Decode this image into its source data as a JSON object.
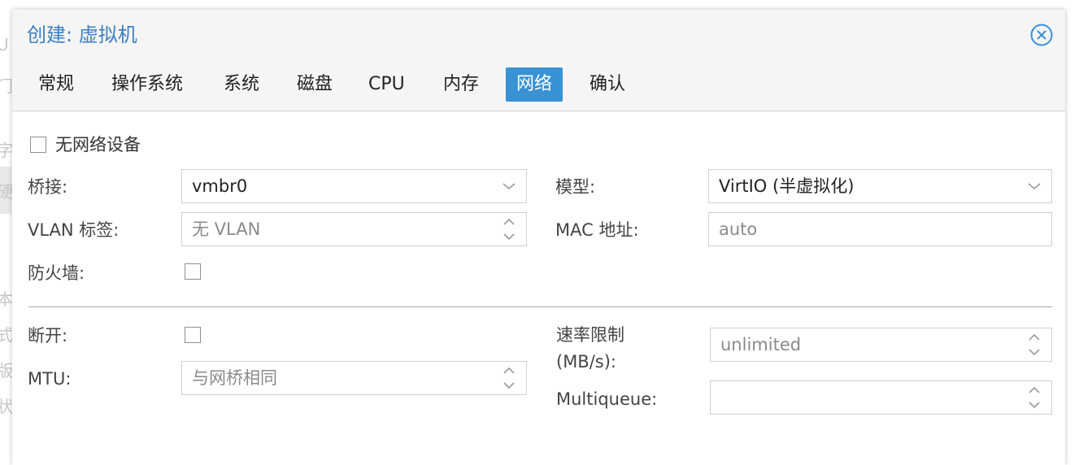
{
  "background_fragments": [
    "U",
    "门",
    "字",
    "硬",
    "本",
    "式",
    "版",
    "状"
  ],
  "dialog": {
    "title": "创建: 虚拟机",
    "close_icon": "close-circle-icon"
  },
  "tabs": [
    {
      "label": "常规",
      "active": false
    },
    {
      "label": "操作系统",
      "active": false
    },
    {
      "label": "系统",
      "active": false
    },
    {
      "label": "磁盘",
      "active": false
    },
    {
      "label": "CPU",
      "active": false
    },
    {
      "label": "内存",
      "active": false
    },
    {
      "label": "网络",
      "active": true
    },
    {
      "label": "确认",
      "active": false
    }
  ],
  "network": {
    "no_device_label": "无网络设备",
    "bridge": {
      "label": "桥接:",
      "value": "vmbr0"
    },
    "model": {
      "label": "模型:",
      "value": "VirtIO (半虚拟化)"
    },
    "vlan": {
      "label": "VLAN 标签:",
      "placeholder": "无 VLAN"
    },
    "mac": {
      "label": "MAC 地址:",
      "placeholder": "auto"
    },
    "firewall": {
      "label": "防火墙:"
    },
    "disconnect": {
      "label": "断开:"
    },
    "rate": {
      "label_line1": "速率限制",
      "label_line2": "(MB/s):",
      "placeholder": "unlimited"
    },
    "mtu": {
      "label": "MTU:",
      "placeholder": "与网桥相同"
    },
    "multiqueue": {
      "label": "Multiqueue:",
      "value": ""
    }
  },
  "colors": {
    "accent": "#3892d4",
    "title": "#3b7fc4"
  }
}
